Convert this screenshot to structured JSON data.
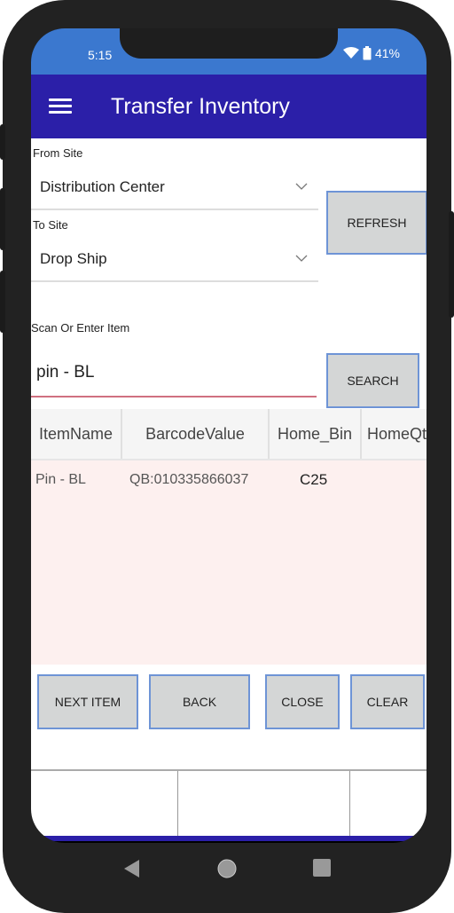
{
  "status_bar": {
    "time": "5:15",
    "battery": "41%",
    "icons": [
      "wifi-icon",
      "battery-icon"
    ]
  },
  "app_bar": {
    "title": "Transfer Inventory",
    "menu_icon": "hamburger-menu-icon"
  },
  "form": {
    "from_site": {
      "label": "From Site",
      "value": "Distribution Center"
    },
    "to_site": {
      "label": "To Site",
      "value": "Drop Ship"
    },
    "refresh_label": "REFRESH",
    "scan": {
      "label": "Scan Or Enter Item",
      "value": "pin - BL",
      "placeholder": ""
    },
    "search_label": "SEARCH"
  },
  "grid": {
    "columns": [
      "ItemName",
      "BarcodeValue",
      "Home_Bin",
      "HomeQty"
    ],
    "rows": [
      {
        "item_name": "Pin - BL",
        "barcode": "QB:010335866037",
        "home_bin": "C25",
        "home_qty": ""
      }
    ]
  },
  "actions": {
    "next_item": "NEXT ITEM",
    "back": "BACK",
    "close": "CLOSE",
    "clear": "CLEAR"
  },
  "colors": {
    "app_bar": "#2b1fa8",
    "status_bar": "#3b78cf",
    "button_bg": "#d4d6d6",
    "button_border": "#6e94d6",
    "grid_row_bg": "#fdf0ef",
    "entry_underline": "#d07080"
  }
}
